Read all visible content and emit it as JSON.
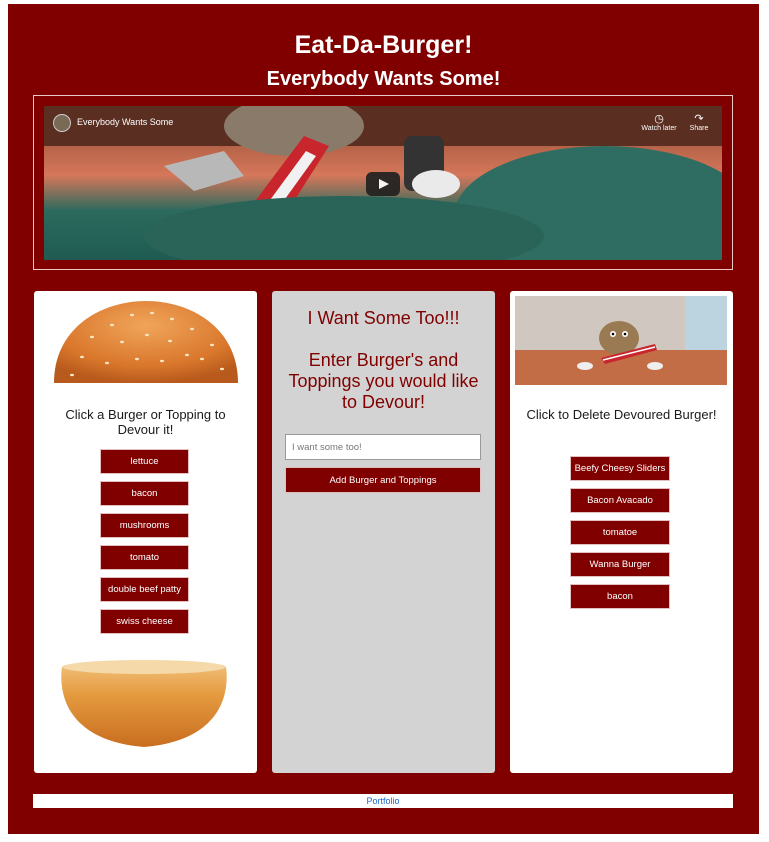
{
  "header": {
    "title": "Eat-Da-Burger!",
    "subtitle": "Everybody Wants Some!"
  },
  "video": {
    "title": "Everybody Wants Some",
    "watch_later_label": "Watch later",
    "share_label": "Share"
  },
  "left_panel": {
    "instruction": "Click a Burger or Topping to Devour it!",
    "items": [
      "lettuce",
      "bacon",
      "mushrooms",
      "tomato",
      "double beef patty",
      "swiss cheese"
    ]
  },
  "middle_panel": {
    "heading_line1": "I Want Some Too!!!",
    "heading_line2": "Enter Burger's and Toppings you would like to Devour!",
    "input_placeholder": "I want some too!",
    "submit_label": "Add Burger and Toppings"
  },
  "right_panel": {
    "instruction": "Click to Delete Devoured Burger!",
    "items": [
      "Beefy Cheesy Sliders",
      "Bacon Avacado",
      "tomatoe",
      "Wanna Burger",
      "bacon"
    ]
  },
  "footer": {
    "link_label": "Portfolio"
  },
  "colors": {
    "brand": "#800000",
    "middle_panel_bg": "#d3d3d3",
    "link": "#1a66cc"
  }
}
